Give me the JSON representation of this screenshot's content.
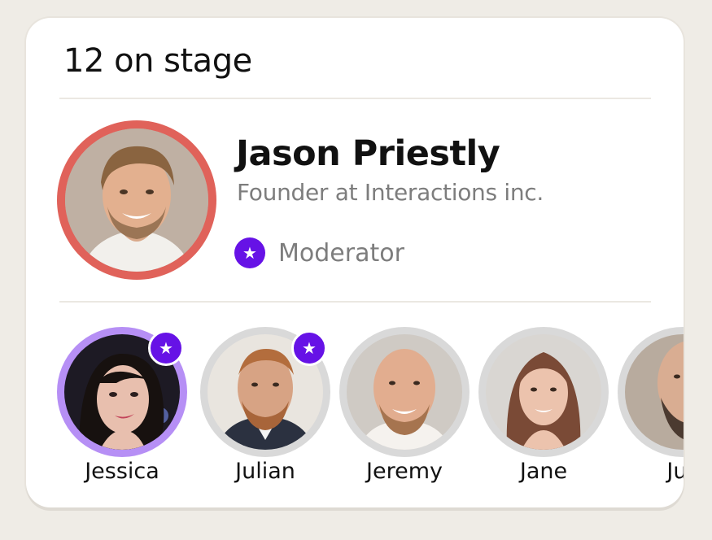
{
  "stage": {
    "title": "12 on stage"
  },
  "host": {
    "name": "Jason Priestly",
    "role": "Founder at Interactions inc.",
    "badge_icon": "star-icon",
    "badge_label": "Moderator",
    "ring_color": "#e0625a"
  },
  "speakers": [
    {
      "name": "Jessica",
      "moderator": true,
      "active": true
    },
    {
      "name": "Julian",
      "moderator": true,
      "active": false
    },
    {
      "name": "Jeremy",
      "moderator": false,
      "active": false
    },
    {
      "name": "Jane",
      "moderator": false,
      "active": false
    },
    {
      "name": "Jus",
      "moderator": false,
      "active": false
    }
  ],
  "colors": {
    "accent": "#6612e6",
    "active_ring": "#b68ff5",
    "idle_ring": "#d9d9d9",
    "background": "#efece6"
  }
}
